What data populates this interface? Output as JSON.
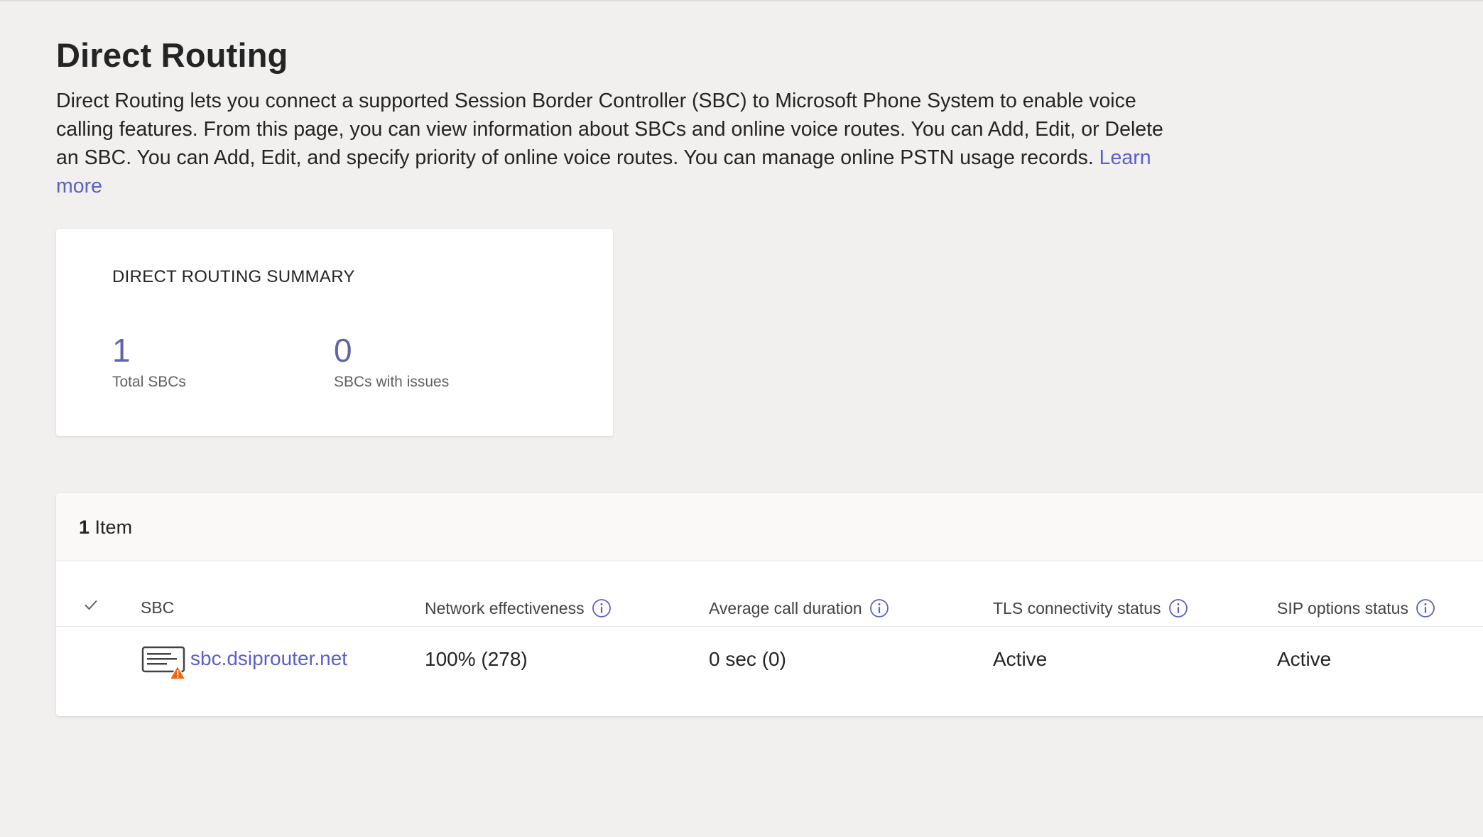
{
  "page": {
    "title": "Direct Routing",
    "description": "Direct Routing lets you connect a supported Session Border Controller (SBC) to Microsoft Phone System to enable voice calling features. From this page, you can view information about SBCs and online voice routes. You can Add, Edit, or Delete an SBC. You can Add, Edit, and specify priority of online voice routes. You can manage online PSTN usage records.",
    "learn_more_label": "Learn more"
  },
  "summary": {
    "title": "DIRECT ROUTING SUMMARY",
    "total_sbcs_value": "1",
    "total_sbcs_label": "Total SBCs",
    "issues_value": "0",
    "issues_label": "SBCs with issues"
  },
  "table": {
    "item_count": "1",
    "item_label": "Item",
    "columns": [
      {
        "label": "SBC",
        "info": false
      },
      {
        "label": "Network effectiveness",
        "info": true
      },
      {
        "label": "Average call duration",
        "info": true
      },
      {
        "label": "TLS connectivity status",
        "info": true
      },
      {
        "label": "SIP options status",
        "info": true
      }
    ],
    "rows": [
      {
        "sbc": "sbc.dsiprouter.net",
        "network_effectiveness": "100% (278)",
        "avg_call_duration": "0 sec (0)",
        "tls_status": "Active",
        "sip_status": "Active",
        "icon": "sbc-warning-icon"
      }
    ]
  },
  "colors": {
    "accent": "#6264a7",
    "link": "#5b5fc7",
    "warning": "#f7630c",
    "background": "#f1f0ef"
  }
}
